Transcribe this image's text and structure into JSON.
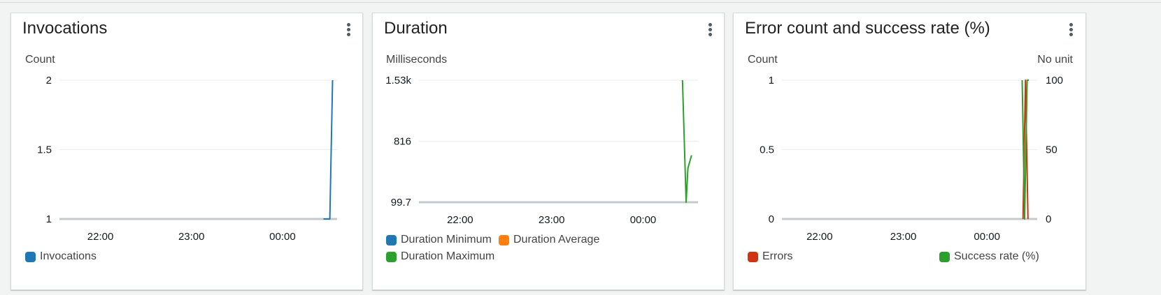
{
  "panels": [
    {
      "id": "invocations",
      "title": "Invocations",
      "left_unit": "Count",
      "legend": [
        {
          "label": "Invocations",
          "color": "#1f77b4"
        }
      ]
    },
    {
      "id": "duration",
      "title": "Duration",
      "left_unit": "Milliseconds",
      "legend": [
        {
          "label": "Duration Minimum",
          "color": "#1f77b4"
        },
        {
          "label": "Duration Average",
          "color": "#ff7f0e"
        },
        {
          "label": "Duration Maximum",
          "color": "#2ca02c"
        }
      ]
    },
    {
      "id": "errors",
      "title": "Error count and success rate (%)",
      "left_unit": "Count",
      "right_unit": "No unit",
      "legend": [
        {
          "label": "Errors",
          "color": "#d13212"
        },
        {
          "label": "Success rate (%)",
          "color": "#2ca02c"
        }
      ]
    }
  ],
  "chart_data": [
    {
      "type": "line",
      "title": "Invocations",
      "ylabel": "Count",
      "x_ticks": [
        "22:00",
        "23:00",
        "00:00"
      ],
      "y_ticks": [
        "1",
        "1.5",
        "2"
      ],
      "ylim": [
        1,
        2
      ],
      "x_domain_hours": [
        21.55,
        24.6
      ],
      "series": [
        {
          "name": "Invocations",
          "color": "#1f77b4",
          "points": [
            [
              24.45,
              1
            ],
            [
              24.52,
              1
            ],
            [
              24.55,
              2
            ]
          ]
        }
      ]
    },
    {
      "type": "line",
      "title": "Duration",
      "ylabel": "Milliseconds",
      "x_ticks": [
        "22:00",
        "23:00",
        "00:00"
      ],
      "y_ticks": [
        "99.7",
        "816",
        "1.53k"
      ],
      "y_tick_values": [
        99.7,
        816,
        1530
      ],
      "ylim": [
        99.7,
        1530
      ],
      "x_domain_hours": [
        21.55,
        24.6
      ],
      "series": [
        {
          "name": "Duration Maximum",
          "color": "#2ca02c",
          "points": [
            [
              24.43,
              1530
            ],
            [
              24.47,
              99.7
            ],
            [
              24.49,
              500
            ],
            [
              24.53,
              650
            ]
          ]
        }
      ]
    },
    {
      "type": "line",
      "title": "Error count and success rate (%)",
      "ylabel": "Count",
      "ylabel_right": "No unit",
      "x_ticks": [
        "22:00",
        "23:00",
        "00:00"
      ],
      "y_ticks": [
        "0",
        "0.5",
        "1"
      ],
      "y_ticks_right": [
        "0",
        "50",
        "100"
      ],
      "ylim": [
        0,
        1
      ],
      "ylim_right": [
        0,
        100
      ],
      "x_domain_hours": [
        21.55,
        24.6
      ],
      "series": [
        {
          "name": "Errors",
          "color": "#d13212",
          "axis": "left",
          "points": [
            [
              24.43,
              0
            ],
            [
              24.46,
              1
            ],
            [
              24.49,
              0
            ]
          ]
        },
        {
          "name": "Success rate (%)",
          "color": "#2ca02c",
          "axis": "right",
          "points": [
            [
              24.42,
              100
            ],
            [
              24.45,
              0
            ],
            [
              24.48,
              100
            ],
            [
              24.5,
              100
            ]
          ]
        }
      ]
    }
  ]
}
